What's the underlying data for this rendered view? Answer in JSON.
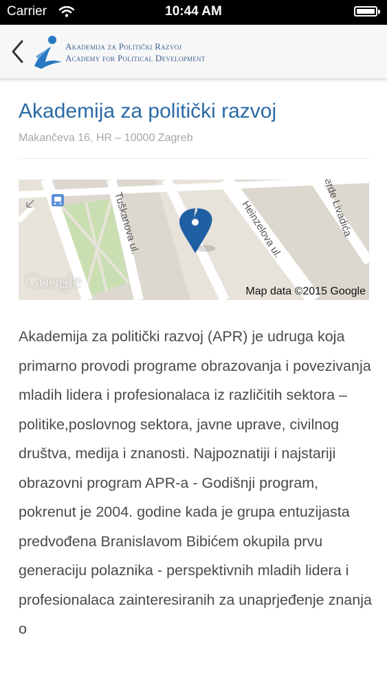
{
  "status_bar": {
    "carrier": "Carrier",
    "time": "10:44 AM"
  },
  "header": {
    "logo_line1": "Akademija za Politički Razvoj",
    "logo_line2": "Academy for Political Development"
  },
  "place": {
    "title": "Akademija za politički razvoj",
    "address": "Makančeva 16, HR – 10000 Zagreb"
  },
  "map": {
    "street_1": "Tuškanova ul.",
    "street_2": "Heinzelova ul.",
    "street_3": "erde Livadića",
    "attribution": "Map data ©2015 Google",
    "logo": "Google",
    "pin_color": "#1f5fa3"
  },
  "description": "Akademija za politički razvoj (APR) je udruga koja primarno provodi programe obrazovanja i povezivanja mladih lidera i profesionalaca iz različitih sektora – politike,poslovnog sektora, javne uprave, civilnog društva, medija i znanosti. Najpoznatiji i najstariji obrazovni program APR-a - Godišnji program, pokrenut je 2004. godine kada je grupa entuzijasta predvođena Branislavom Bibićem okupila prvu generaciju polaznika - perspektivnih mladih lidera i profesionalaca zainteresiranih za unaprjeđenje znanja o"
}
